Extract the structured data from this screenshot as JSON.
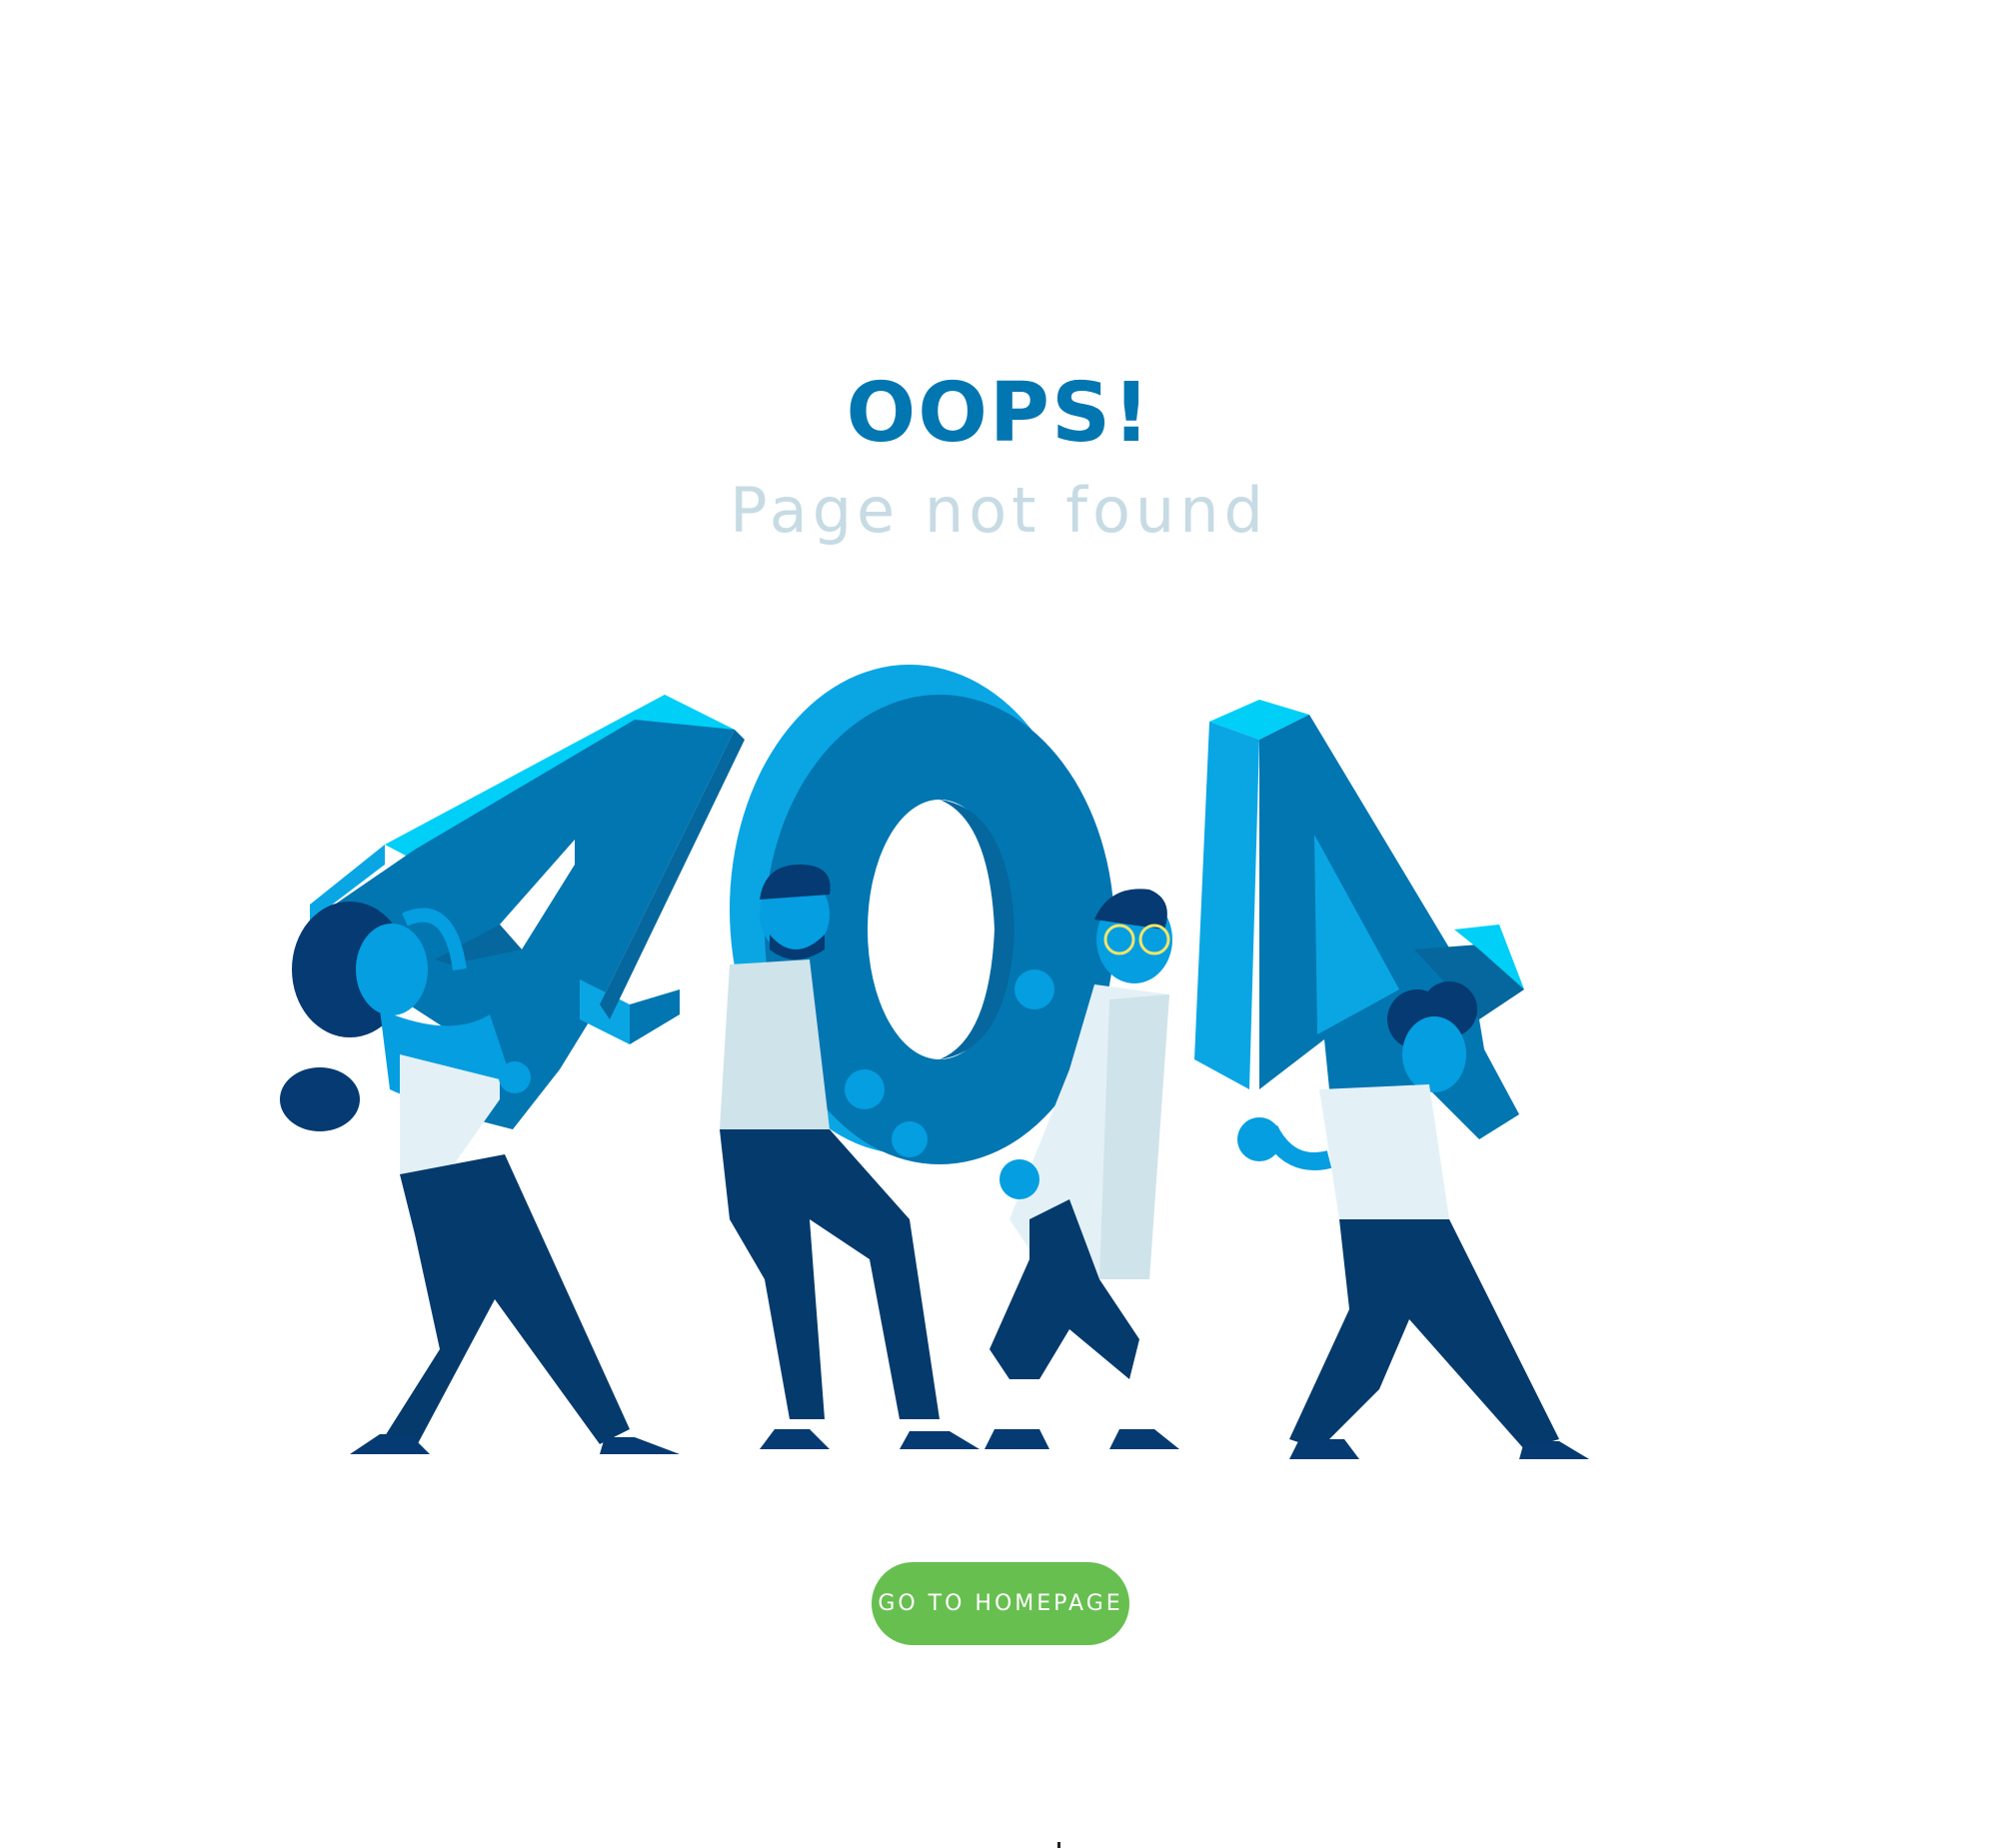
{
  "page": {
    "headline": "OOPS!",
    "subheadline": "Page not found"
  },
  "illustration": {
    "caption": "404",
    "colors": {
      "digit_face": "#0276b1",
      "digit_side": "#0aa6e4",
      "digit_top": "#00cff7",
      "digit_dark": "#05679d",
      "skin": "#049ee1",
      "hair": "#053a72",
      "pants": "#053a6c",
      "shirt": "#e3f1f7"
    }
  },
  "actions": {
    "homepage_button_label": "GO TO HOMEPAGE"
  },
  "colors": {
    "headline": "#0276b1",
    "subheadline": "#c7dbe4",
    "button_background": "#67bf50",
    "button_text": "#ffffff",
    "page_background": "#ffffff"
  }
}
